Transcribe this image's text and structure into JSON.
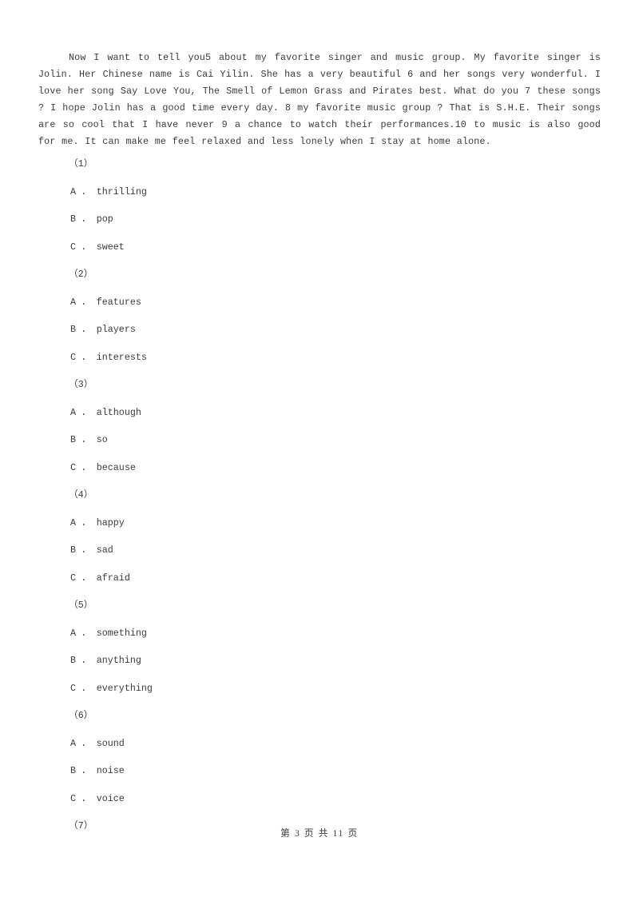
{
  "passage": {
    "text": "Now I want to tell you5 about my favorite singer and music group. My favorite singer is Jolin. Her Chinese name is Cai Yilin. She has a very beautiful 6 and her songs very wonderful. I love her song Say Love You, The Smell of Lemon Grass and Pirates best. What do you 7 these songs ? I hope Jolin has a good time every day.  8 my favorite music group ? That is S.H.E. Their songs are so cool that I have never 9 a chance to watch their performances.10 to music is also good for me. It can make me feel relaxed and less lonely when I stay at home alone."
  },
  "questions": [
    {
      "number": "（1）",
      "options": [
        {
          "letter": "A",
          "sep": "．",
          "text": "thrilling"
        },
        {
          "letter": "B",
          "sep": "．",
          "text": "pop"
        },
        {
          "letter": "C",
          "sep": "．",
          "text": "sweet"
        }
      ]
    },
    {
      "number": "（2）",
      "options": [
        {
          "letter": "A",
          "sep": "．",
          "text": "features"
        },
        {
          "letter": "B",
          "sep": "．",
          "text": "players"
        },
        {
          "letter": "C",
          "sep": "．",
          "text": "interests"
        }
      ]
    },
    {
      "number": "（3）",
      "options": [
        {
          "letter": "A",
          "sep": "．",
          "text": "although"
        },
        {
          "letter": "B",
          "sep": "．",
          "text": "so"
        },
        {
          "letter": "C",
          "sep": "．",
          "text": "because"
        }
      ]
    },
    {
      "number": "（4）",
      "options": [
        {
          "letter": "A",
          "sep": "．",
          "text": "happy"
        },
        {
          "letter": "B",
          "sep": "．",
          "text": "sad"
        },
        {
          "letter": "C",
          "sep": "．",
          "text": "afraid"
        }
      ]
    },
    {
      "number": "（5）",
      "options": [
        {
          "letter": "A",
          "sep": "．",
          "text": "something"
        },
        {
          "letter": "B",
          "sep": "．",
          "text": "anything"
        },
        {
          "letter": "C",
          "sep": "．",
          "text": "everything"
        }
      ]
    },
    {
      "number": "（6）",
      "options": [
        {
          "letter": "A",
          "sep": "．",
          "text": "sound"
        },
        {
          "letter": "B",
          "sep": "．",
          "text": "noise"
        },
        {
          "letter": "C",
          "sep": "．",
          "text": "voice"
        }
      ]
    },
    {
      "number": "（7）",
      "options": []
    }
  ],
  "footer": {
    "text": "第 3 页 共 11 页"
  },
  "colors": {
    "page_background": "#ffffff",
    "body_text": "#3b3b3b"
  }
}
